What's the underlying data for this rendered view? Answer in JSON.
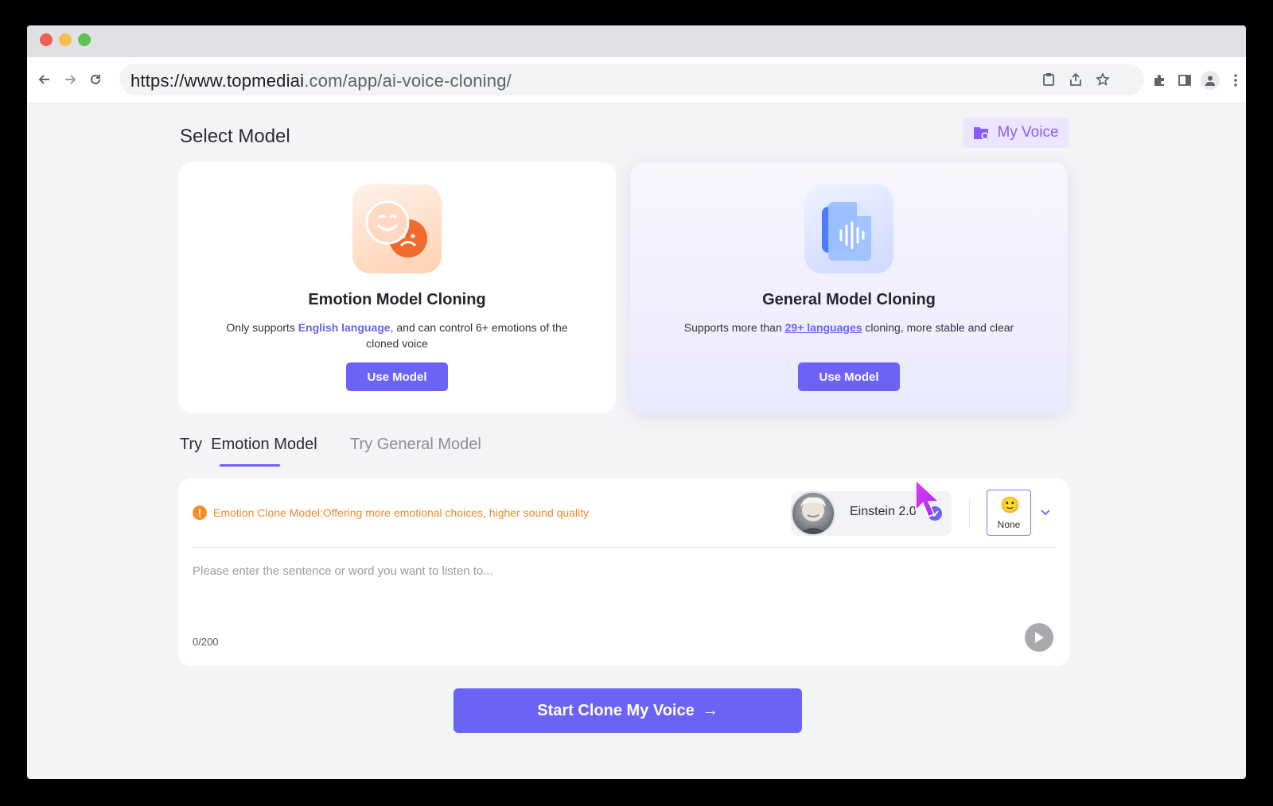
{
  "browser": {
    "url_main": "https://www.topmediai",
    "url_rest": ".com/app/ai-voice-cloning/"
  },
  "page": {
    "section_title": "Select Model",
    "my_voice_label": "My Voice"
  },
  "cards": [
    {
      "title": "Emotion Model Cloning",
      "desc_prefix": "Only supports ",
      "desc_highlight": "English language",
      "desc_suffix": ", and can control 6+ emotions of the cloned voice",
      "button_label": "Use Model"
    },
    {
      "title": "General Model Cloning",
      "desc_prefix": "Supports more than ",
      "desc_highlight": "29+ languages",
      "desc_suffix": " cloning, more stable and clear",
      "button_label": "Use Model"
    }
  ],
  "tabs": {
    "active_prefix": "Try",
    "active_main": "Emotion Model",
    "inactive": "Try General Model"
  },
  "try_panel": {
    "notice": "Emotion Clone Model:Offering more emotional choices, higher sound quality",
    "voice_name": "Einstein 2.0",
    "emotion_emoji": "🙂",
    "emotion_label": "None",
    "placeholder": "Please enter the sentence or word you want to listen to...",
    "counter": "0/200"
  },
  "cta": {
    "label": "Start Clone My Voice",
    "arrow": "→"
  },
  "colors": {
    "accent": "#6b63f6",
    "notice": "#f0892a",
    "my_voice_text": "#8a5cf6"
  }
}
